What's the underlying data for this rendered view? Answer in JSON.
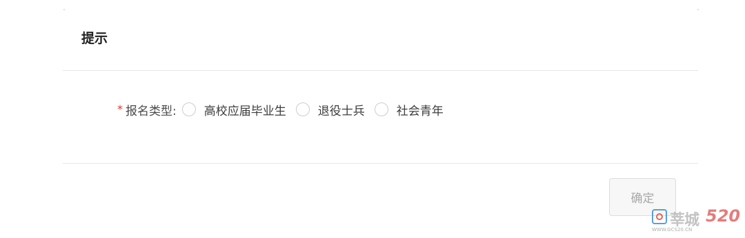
{
  "dialog": {
    "title": "提示",
    "form": {
      "required_mark": "*",
      "label": "报名类型:",
      "options": [
        {
          "label": "高校应届毕业生",
          "checked": false
        },
        {
          "label": "退役士兵",
          "checked": false
        },
        {
          "label": "社会青年",
          "checked": false
        }
      ]
    },
    "footer": {
      "confirm_label": "确定",
      "confirm_disabled": true
    }
  },
  "watermark": {
    "name": "莘城",
    "number": "520",
    "url": "WWW.GCS20.CN"
  },
  "colors": {
    "required": "#e0352b",
    "divider": "#e6e6e6",
    "button_disabled_text": "#a8a8a8"
  }
}
